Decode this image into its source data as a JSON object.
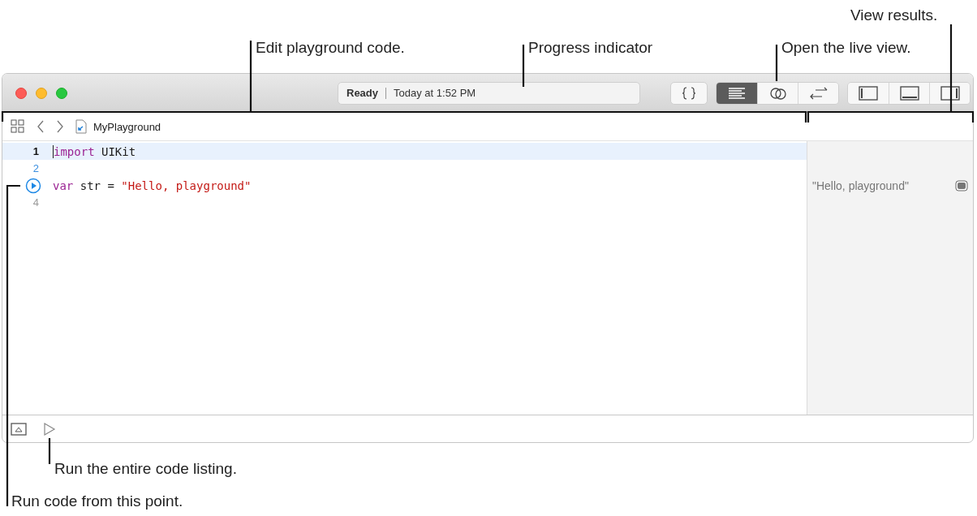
{
  "window": {
    "status": {
      "state": "Ready",
      "time": "Today at 1:52 PM"
    },
    "editor_mode_buttons": [
      {
        "selected": true
      },
      {
        "selected": false
      },
      {
        "selected": false
      }
    ],
    "layout_buttons": [
      {
        "selected": false
      },
      {
        "selected": false
      },
      {
        "selected": false
      }
    ]
  },
  "navigation": {
    "file": "MyPlayground"
  },
  "editor": {
    "lines": [
      {
        "number": "1",
        "kind": "current",
        "tokens": [
          {
            "kind": "keyword",
            "text": "import"
          },
          {
            "kind": "plain",
            "text": " UIKit"
          }
        ]
      },
      {
        "number": "2",
        "kind": "executed"
      },
      {
        "kind": "run-point",
        "tokens": [
          {
            "kind": "keyword",
            "text": "var"
          },
          {
            "kind": "plain",
            "text": " str = "
          },
          {
            "kind": "string",
            "text": "\"Hello, playground\""
          }
        ],
        "result": "\"Hello, playground\""
      },
      {
        "number": "4",
        "kind": "idle"
      }
    ]
  },
  "callouts": [
    {
      "text": "View results."
    },
    {
      "text": "Edit playground code."
    },
    {
      "text": "Progress indicator"
    },
    {
      "text": "Open the live view."
    },
    {
      "text": "Run the entire code listing."
    },
    {
      "text": "Run code from this point."
    }
  ]
}
